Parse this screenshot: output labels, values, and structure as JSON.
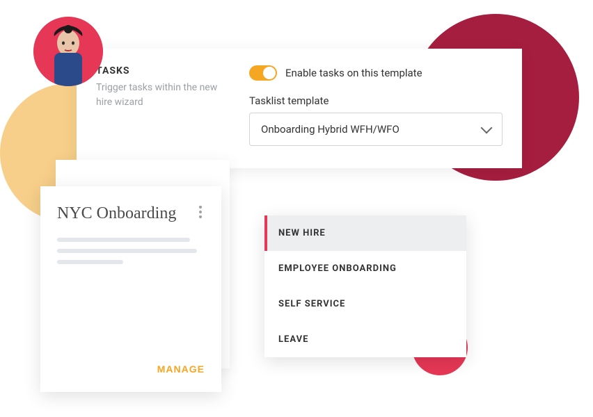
{
  "tasks": {
    "title": "TASKS",
    "description": "Trigger tasks within the new hire wizard",
    "toggle_label": "Enable tasks on this template",
    "select_label": "Tasklist template",
    "select_value": "Onboarding Hybrid WFH/WFO"
  },
  "card": {
    "title": "NYC Onboarding",
    "manage_label": "MANAGE"
  },
  "menu": {
    "items": [
      "NEW HIRE",
      "EMPLOYEE ONBOARDING",
      "SELF SERVICE",
      "LEAVE"
    ],
    "active_index": 0
  },
  "colors": {
    "accent_orange": "#f5a623",
    "accent_red": "#e63756",
    "deep_red": "#a61e3f",
    "peach": "#f7cf8a"
  }
}
